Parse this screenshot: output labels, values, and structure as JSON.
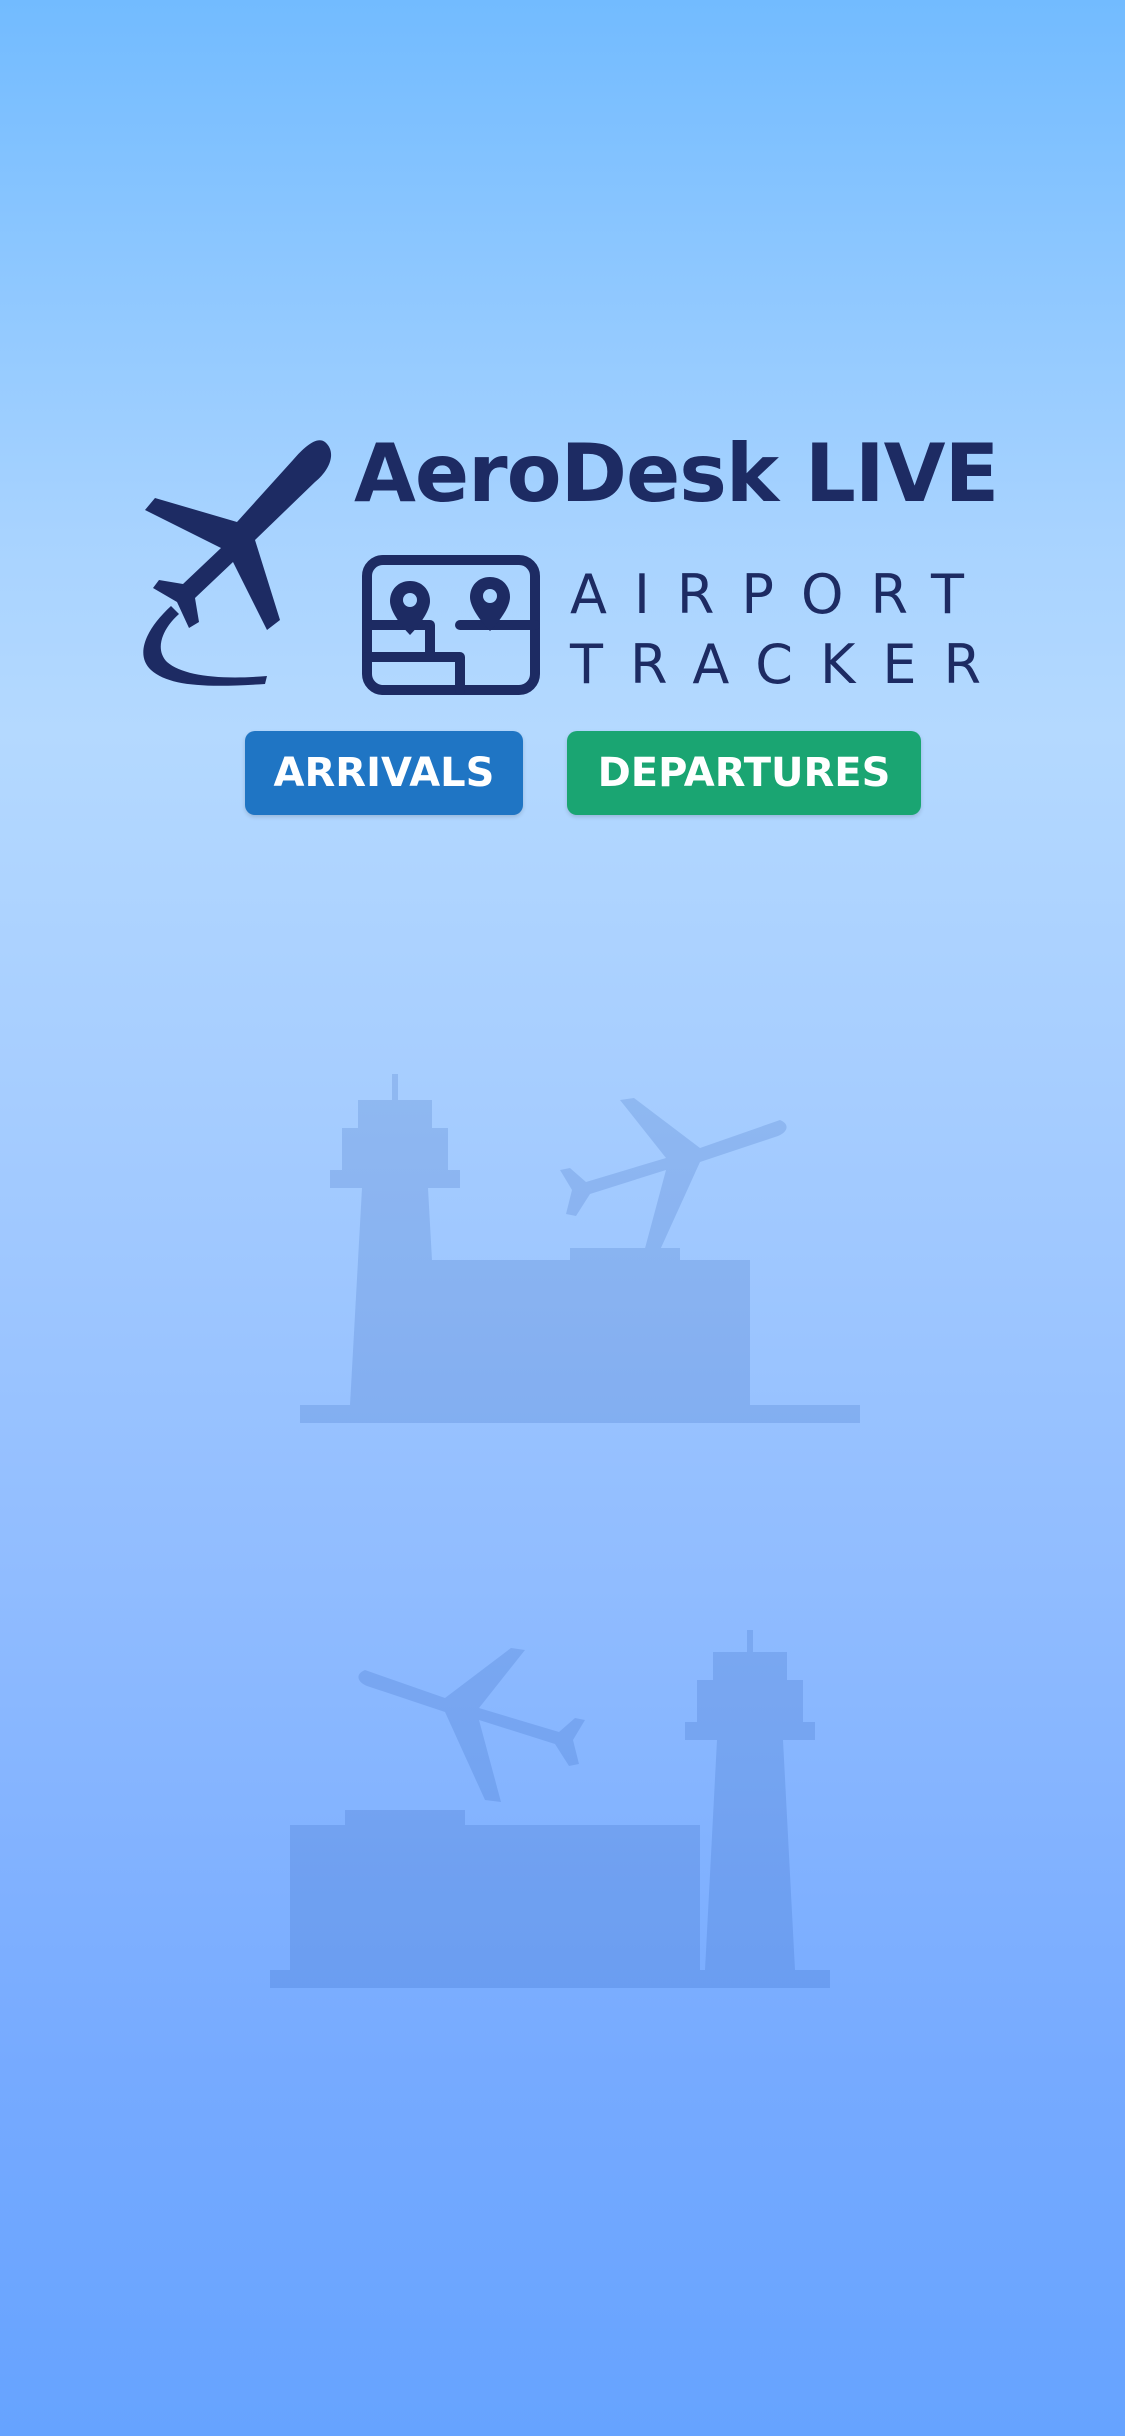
{
  "brand": {
    "title": "AeroDesk LIVE",
    "subtitle_line1": "AIRPORT",
    "subtitle_line2": "TRACKER",
    "icons": [
      "airplane-takeoff-icon",
      "map-pins-icon"
    ]
  },
  "buttons": {
    "arrivals_label": "ARRIVALS",
    "departures_label": "DEPARTURES"
  },
  "background": {
    "illustrations": [
      "control-tower-icon",
      "airplane-icon",
      "terminal-building-icon"
    ]
  },
  "colors": {
    "brand_navy": "#1d2b63",
    "arrivals": "#1f75c4",
    "departures": "#1aa572",
    "gradient_top": "#72bbff",
    "gradient_bottom": "#66a3ff"
  }
}
